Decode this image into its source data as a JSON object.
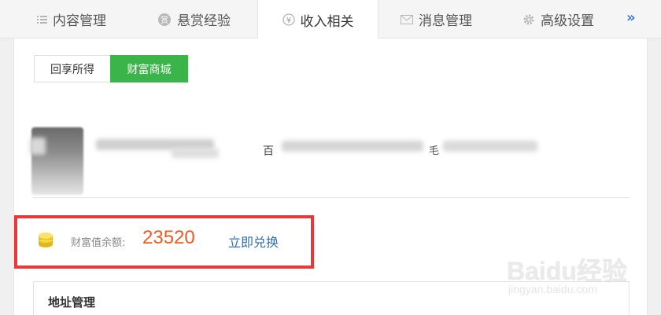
{
  "tabs": [
    {
      "label": "内容管理",
      "icon": "list-icon"
    },
    {
      "label": "悬赏经验",
      "icon": "bounty-coin-icon"
    },
    {
      "label": "收入相关",
      "icon": "yen-icon",
      "active": true
    },
    {
      "label": "消息管理",
      "icon": "mail-icon"
    },
    {
      "label": "高级设置",
      "icon": "gear-icon"
    }
  ],
  "more_label": "»",
  "subtabs": {
    "first": "回享所得",
    "second": "财富商城"
  },
  "profile": {
    "partial_text_1": "百",
    "partial_text_2": "毛"
  },
  "wealth": {
    "label": "财富值余额:",
    "value": "23520",
    "action": "立即兑换"
  },
  "address": {
    "title": "地址管理"
  },
  "watermark": {
    "logo": "Baidu经验",
    "url": "jingyan.baidu.com"
  },
  "colors": {
    "accent_green": "#3bb54a",
    "highlight_red": "#e8383a",
    "value_orange": "#ef5a22",
    "link_blue": "#2f6fb5"
  }
}
